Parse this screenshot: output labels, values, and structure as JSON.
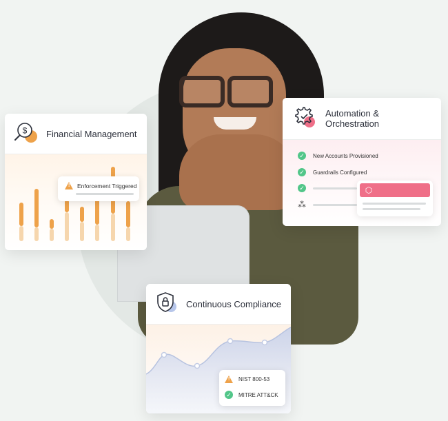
{
  "cards": {
    "financial": {
      "title": "Financial Management",
      "alert": "Enforcement Triggered"
    },
    "automation": {
      "title": "Automation & Orchestration",
      "items": [
        {
          "label": "New Accounts Provisioned",
          "status": "done"
        },
        {
          "label": "Guardrails Configured",
          "status": "done"
        },
        {
          "label": "",
          "status": "done"
        },
        {
          "label": "",
          "status": "in-progress"
        }
      ]
    },
    "compliance": {
      "title": "Continuous Compliance",
      "frameworks": [
        {
          "label": "NIST 800-53",
          "status": "warning"
        },
        {
          "label": "MITRE ATT&CK",
          "status": "pass"
        }
      ]
    }
  },
  "colors": {
    "accent_orange": "#eea24a",
    "accent_pink": "#ef6f88",
    "accent_green": "#52c689",
    "accent_blue": "#b7c6ea"
  },
  "icons": {
    "financial": "dollar-search-icon",
    "automation": "gear-check-icon",
    "compliance": "shield-lock-icon"
  }
}
